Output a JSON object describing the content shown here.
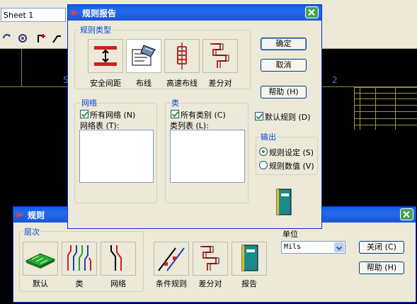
{
  "background": {
    "sheet_combo": "Sheet 1",
    "ruler_numbers": [
      "5",
      "2"
    ]
  },
  "report_dialog": {
    "title": "规则报告",
    "rule_type_group": "规则类型",
    "rule_types": [
      {
        "label": "安全间距",
        "icon": "clearance-icon"
      },
      {
        "label": "布线",
        "icon": "routing-icon"
      },
      {
        "label": "高速布线",
        "icon": "high-speed-icon"
      },
      {
        "label": "差分对",
        "icon": "diff-pair-icon"
      }
    ],
    "ok_label": "确定",
    "cancel_label": "取消",
    "help_label": "帮助 (H)",
    "net_group": "网络",
    "all_nets_label": "所有网络 (N)",
    "net_list_label": "网络表 (T):",
    "class_group": "类",
    "all_classes_label": "所有类别 (C)",
    "class_list_label": "类列表 (L):",
    "default_rules_label": "默认规则 (D)",
    "output_group": "输出",
    "output_options": [
      "规则设定 (S)",
      "规则数值 (V)"
    ],
    "selected_output": "规则设定 (S)"
  },
  "rules_dialog": {
    "title": "规则",
    "hierarchy_group": "层次",
    "hierarchy_items": [
      {
        "label": "默认",
        "icon": "pcb-board-icon"
      },
      {
        "label": "类",
        "icon": "class-traces-icon"
      },
      {
        "label": "网络",
        "icon": "net-trace-icon"
      }
    ],
    "tool_items": [
      {
        "label": "条件规则",
        "icon": "conditional-rule-icon"
      },
      {
        "label": "差分对",
        "icon": "diff-pair-icon"
      },
      {
        "label": "报告",
        "icon": "report-icon"
      }
    ],
    "unit_label": "单位",
    "unit_value": "Mils",
    "close_label": "关闭 (C)",
    "help_label": "帮助 (H)"
  },
  "colors": {
    "titlebar": "#0a5ff0",
    "dialog_bg": "#ece9d8",
    "group_label": "#0046d5",
    "canvas": "#000000"
  }
}
